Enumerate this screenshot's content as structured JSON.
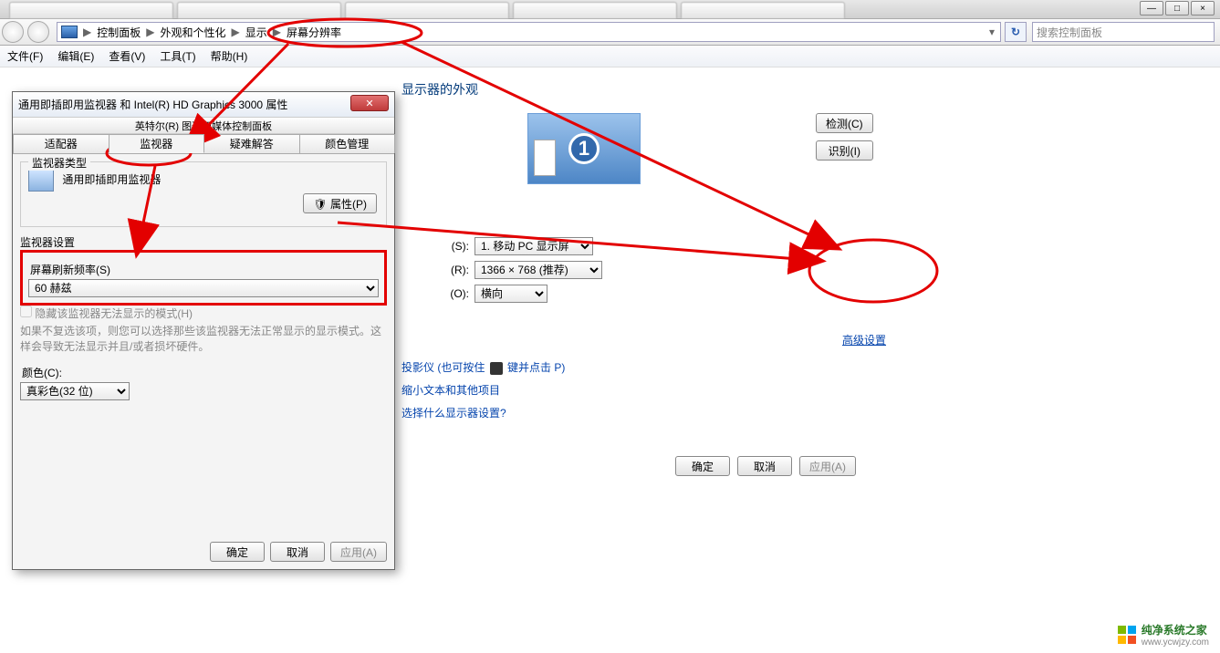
{
  "win_buttons": {
    "min": "—",
    "max": "□",
    "close": "×"
  },
  "tabs_top": [
    "…",
    "…",
    "…",
    "…",
    "…"
  ],
  "breadcrumb": {
    "root": "控制面板",
    "a": "外观和个性化",
    "b": "显示",
    "c": "屏幕分辨率"
  },
  "search": {
    "placeholder": "搜索控制面板"
  },
  "menu": {
    "file": "文件(F)",
    "edit": "编辑(E)",
    "view": "查看(V)",
    "tools": "工具(T)",
    "help": "帮助(H)"
  },
  "page": {
    "heading": "显示器的外观",
    "preview_num": "1",
    "detect": "检测(C)",
    "identify": "识别(I)",
    "display_label": "(S):",
    "display_value": "1. 移动 PC 显示屏",
    "res_label": "(R):",
    "res_value": "1366 × 768 (推荐)",
    "orient_label": "(O):",
    "orient_value": "横向",
    "advanced": "高级设置",
    "proj": "投影仪 (也可按住 ",
    "proj_suffix": " 键并点击 P)",
    "textsize": "缩小文本和其他项目",
    "whichdisplay": "选择什么显示器设置?",
    "ok": "确定",
    "cancel": "取消",
    "apply": "应用(A)"
  },
  "dialog": {
    "title": "通用即插即用监视器 和 Intel(R) HD Graphics 3000 属性",
    "subbar": "英特尔(R) 图形和媒体控制面板",
    "tab1": "适配器",
    "tab2": "监视器",
    "tab3": "疑难解答",
    "tab4": "颜色管理",
    "montype": "监视器类型",
    "monname": "通用即插即用监视器",
    "propbtn": "属性(P)",
    "monset": "监视器设置",
    "refresh_label": "屏幕刷新频率(S)",
    "refresh_value": "60 赫兹",
    "hidechk": "隐藏该监视器无法显示的模式(H)",
    "hidenote": "如果不复选该项，则您可以选择那些该监视器无法正常显示的显示模式。这样会导致无法显示并且/或者损坏硬件。",
    "color_label": "颜色(C):",
    "color_value": "真彩色(32 位)",
    "ok": "确定",
    "cancel": "取消",
    "apply": "应用(A)"
  },
  "footer": {
    "brand": "纯净系统之家",
    "url": "www.ycwjzy.com"
  }
}
